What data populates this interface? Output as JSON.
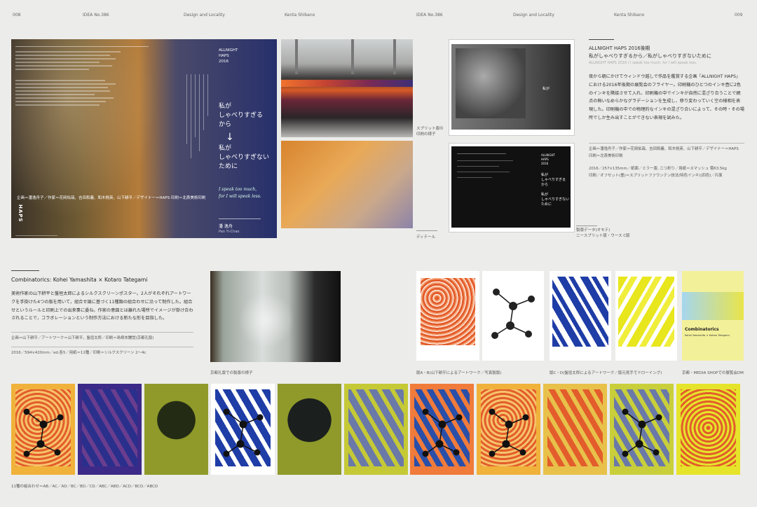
{
  "header": {
    "page_left": "008",
    "issue_left": "IDEA No.386",
    "section_left": "Design and Locality",
    "author_left": "Kenta Shibano",
    "issue_right": "IDEA No.386",
    "section_right": "Design and Locality",
    "author_right": "Kenta Shibano",
    "page_right": "009"
  },
  "haps": {
    "poster_brand": "ALLNIGHT\nHAPS\n2016",
    "poster_title_a": "私が\nしゃべりすぎる\nから",
    "poster_arrow": "↓",
    "poster_title_b": "私が\nしゃべりすぎない\nために",
    "poster_en": "I speak too much,\nfor I will speak less.",
    "poster_artist": "潘 逸舟",
    "poster_artist_en": "Pan Yi-Chao",
    "left_sidebar_name": "潘逸舟",
    "left_sidebar_tag": "HAPS",
    "caption_process": "スプリット版の\n印刷の様子",
    "caption_die": "ディテール",
    "caption_plate": "製版データ(オモテ)\nニースプリット版・ウース C版",
    "title_en": "ALLNIGHT HAPS 2016後期",
    "title_jp": "私がしゃべりすぎるから／私がしゃべりすぎないために",
    "subtitle_en": "ALLNIGHT HAPS 2016 / I speak too much, for I will speak less.",
    "body": "夜から朝にかけてウィンドウ越しで作品を鑑賞する企画「ALLNIGHT HAPS」における2016年後期の展覧会のフライヤー。印刷機のひとつのインキ壺に2色のインキを隣接させて入れ、印刷機の中でインキが自然に混ざり合うことで網点の無いなめらかなグラデーションを生成し、移り変わっていく空の様相を表現した。印刷機の中での物理的なインキの混ざり合いによって、その時・その場所でしか生み出すことができない表現を試みた。",
    "credits": "企画＝潘逸舟子／作家＝花岡佑哉、吉田和義、和木桃英、山下耕平／デザイナー＝HAPS\n印刷＝北斎美術印刷",
    "spec": "2016／257×135mm／紙面／ミラー版, 二つ折り／用紙＝スマッシュ 菊63.5kg\n印刷／オフセット(墨)＝スプリットファウンテン技法(特色インキ)(四色)／片面"
  },
  "combi": {
    "title": "Combinatorics: Kohei Yamashita × Kotaro Tategami",
    "body": "美術作家の山下耕平と盤垣太郎によるシルクスクリーンポスター。2人がそれぞれアートワークを手掛けた4つの版を用いて，組合せ論に基づく11種類の組合わせに沿って制作した。組合せというルールと印刷上での出来事に委ね，作家の意図とは離れた場所でイメージが掛け合わされることで，コラボレーションという制作方法における新たな形を目指した。",
    "credits": "企画＝山下耕平／アートワーク＝山下耕平，盤垣太郎／印刷＝島崎本舗覚(京都孔版)",
    "spec": "2016／594×420mm／ed.各5／用紙＝11種／印刷＝シルクスクリーン 2〜4c",
    "caption_studio": "京都孔版での製版の様子",
    "caption_ab": "版A・B(山下耕平によるアートワーク／写真製版)",
    "caption_cd": "版C・D(盤垣太郎によるアートワーク／版元見手でドローイング)",
    "caption_dm": "京都・MEDIA SHOPでの展覧会DM",
    "dm_title": "Combinatorics",
    "dm_sub": "Kohei Yamashita × Kotaro Tategami",
    "bottom_caption": "11種の組合わせ＝AB／AC／AD／BC／BD／CD／ABC／ABD／ACD／BCD／ABCD"
  },
  "colors": {
    "bg": "#ececea",
    "navy": "#27306b",
    "orange": "#e35d2c",
    "blue": "#1f3da6",
    "yellow": "#e3e21a",
    "olive": "#8f9a2a",
    "purple": "#3b2a88"
  }
}
